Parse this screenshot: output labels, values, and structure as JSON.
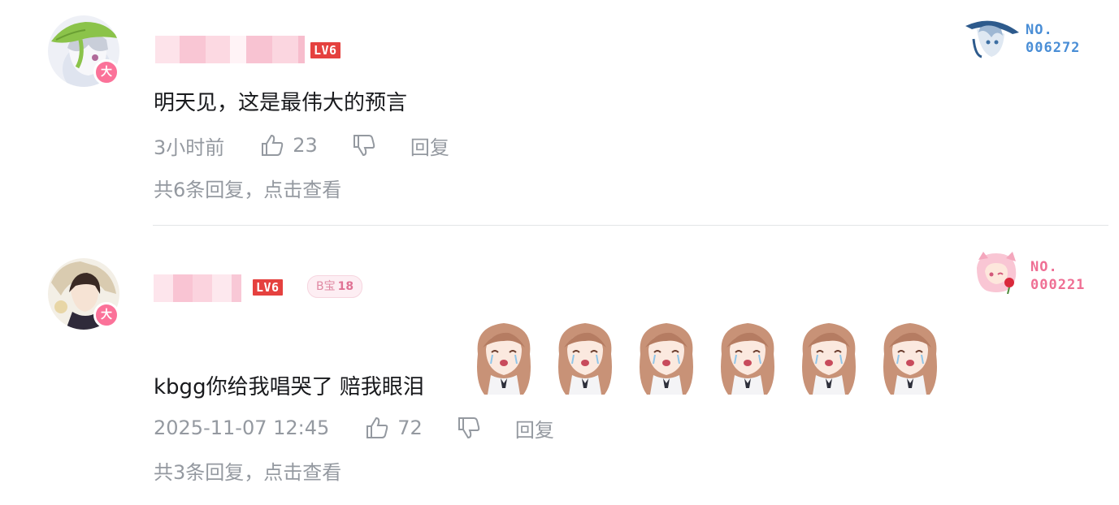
{
  "comments": [
    {
      "level": "LV6",
      "avatar_badge": "大",
      "text": "明天见，这是最伟大的预言",
      "time": "3小时前",
      "likes": "23",
      "reply_label": "回复",
      "replies_summary": "共6条回复，点击查看",
      "card_no_label": "NO.",
      "card_no_value": "006272",
      "card_color": "#4a8ed6"
    },
    {
      "level": "LV6",
      "avatar_badge": "大",
      "fan_badge_name": "B宝",
      "fan_badge_level": "18",
      "text": "kbgg你给我唱哭了 赔我眼泪",
      "time": "2025-11-07 12:45",
      "likes": "72",
      "reply_label": "回复",
      "replies_summary": "共3条回复，点击查看",
      "card_no_label": "NO.",
      "card_no_value": "000221",
      "card_color": "#ef6f94",
      "emoji_count": 6
    }
  ],
  "colors": {
    "accent_pink": "#fb7299",
    "level_red": "#e5413f",
    "meta_gray": "#9499a0",
    "text": "#18191c"
  }
}
